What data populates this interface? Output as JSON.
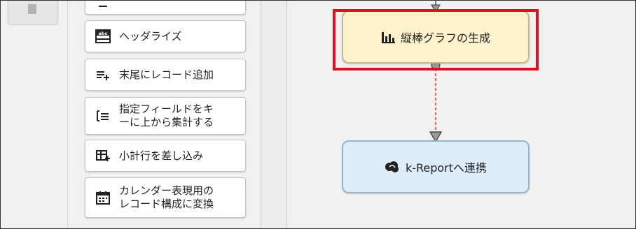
{
  "palette": {
    "items": [
      {
        "label": "",
        "icon": "truncated-item-icon"
      },
      {
        "label": "ヘッダライズ",
        "icon": "abc-header-icon"
      },
      {
        "label": "末尾にレコード追加",
        "icon": "append-list-icon"
      },
      {
        "label": "指定フィールドをキ\nーに上から集計する",
        "icon": "aggregate-list-icon"
      },
      {
        "label": "小計行を差し込み",
        "icon": "subtotal-table-icon"
      },
      {
        "label": "カレンダー表現用の\nレコード構成に変換",
        "icon": "calendar-icon"
      }
    ]
  },
  "canvas": {
    "nodes": [
      {
        "label": "縦棒グラフの生成",
        "icon": "bar-chart-icon",
        "selected": true
      },
      {
        "label": "k-Reportへ連携",
        "icon": "k-report-logo-icon"
      }
    ],
    "colors": {
      "chart_node_bg": "#fdf2cc",
      "report_node_bg": "#dcecf9",
      "selection": "#e01020",
      "connector": "#e03030"
    }
  }
}
